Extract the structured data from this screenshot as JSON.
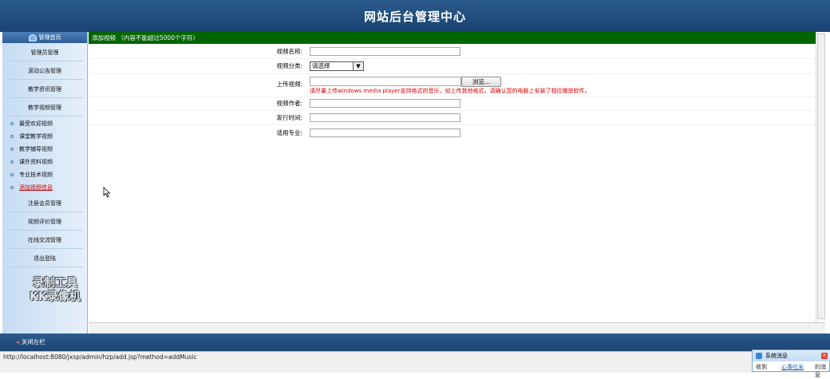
{
  "header": {
    "title": "网站后台管理中心"
  },
  "sidebar": {
    "head_label": "管理首页",
    "items_top": [
      "管理员管理",
      "滚动公告管理",
      "教学资讯管理",
      "教学视频管理"
    ],
    "subitems": [
      "最受欢迎视频",
      "课堂教学视频",
      "教学辅导视频",
      "课外资料视频",
      "专业技术视频",
      "添加视频信息"
    ],
    "items_bottom": [
      "注册会员管理",
      "视频评价管理",
      "在线交流管理",
      "退出登陆"
    ],
    "watermark_line1": "录制工具",
    "watermark_line2": "KK录像机"
  },
  "form": {
    "header": "添加视频 （内容不能超过5000个字符）",
    "labels": {
      "name": "视频名称:",
      "category": "视频分类:",
      "upload": "上传视频:",
      "author": "视频作者:",
      "release": "发行时间:",
      "major": "适用专业:"
    },
    "values": {
      "name": "",
      "author": "",
      "release": "",
      "major": "",
      "upload": ""
    },
    "category_selected": "请选择",
    "browse_label": "浏览...",
    "upload_hint": "请尽量上传windows media player支持格式的音乐，如上传其他格式，请确认您的电脑上安装了相应播放软件。"
  },
  "bottom_bar": {
    "close_left": "关闭左栏"
  },
  "status_bar": {
    "url": "http://localhost:8080/jxsp/admin/hzp/add.jsp?method=addMusic"
  },
  "popup": {
    "title": "系统消息",
    "link1": "收到",
    "link2": "心事吐米",
    "link3": "的消息"
  },
  "colors": {
    "header_bg": "#1f4c7d",
    "form_header_bg": "#006400",
    "hint": "#dd0000",
    "active_menu": "#cc0000"
  }
}
